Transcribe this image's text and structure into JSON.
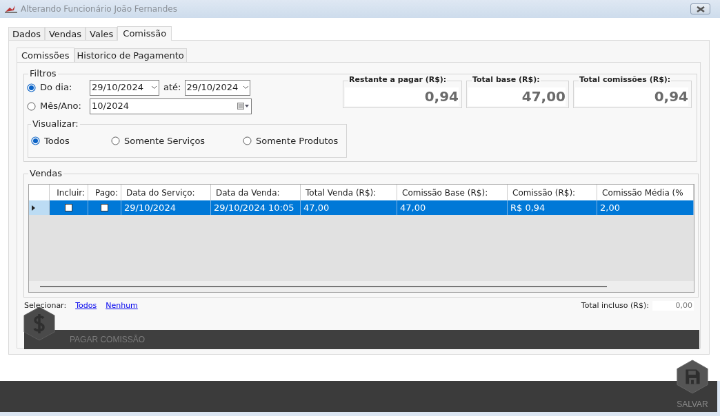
{
  "window": {
    "title": "Alterando Funcionário João Fernandes"
  },
  "tabs": [
    {
      "label": "Dados",
      "selected": false
    },
    {
      "label": "Vendas",
      "selected": false
    },
    {
      "label": "Vales",
      "selected": false
    },
    {
      "label": "Comissão",
      "selected": true
    }
  ],
  "subtabs": [
    {
      "label": "Comissões",
      "selected": true
    },
    {
      "label": "Historico de Pagamento",
      "selected": false
    }
  ],
  "filters": {
    "legend": "Filtros",
    "options": [
      {
        "kind": "range",
        "label": "Do dia:",
        "selected": true,
        "from": "29/10/2024",
        "to_label": "até:",
        "to": "29/10/2024"
      },
      {
        "kind": "month",
        "label": "Mês/Ano:",
        "selected": false,
        "value": "10/2024"
      }
    ],
    "view": {
      "legend": "Visualizar:",
      "options": [
        {
          "label": "Todos",
          "selected": true
        },
        {
          "label": "Somente Serviços",
          "selected": false
        },
        {
          "label": "Somente Produtos",
          "selected": false
        }
      ]
    }
  },
  "totals": [
    {
      "label": "Restante a pagar (R$):",
      "value": "0,94"
    },
    {
      "label": "Total base (R$):",
      "value": "47,00"
    },
    {
      "label": "Total comissões (R$):",
      "value": "0,94"
    }
  ],
  "sales": {
    "legend": "Vendas",
    "columns": [
      "Incluir:",
      "Pago:",
      "Data do Serviço:",
      "Data da Venda:",
      "Total Venda (R$):",
      "Comissão Base (R$):",
      "Comissão (R$):",
      "Comissão Média (%"
    ],
    "rows": [
      {
        "selected": true,
        "cells": [
          {
            "kind": "checkbox",
            "checked": false
          },
          {
            "kind": "checkbox",
            "checked": false
          },
          {
            "kind": "text",
            "text": "29/10/2024"
          },
          {
            "kind": "text",
            "text": "29/10/2024 10:05"
          },
          {
            "kind": "text",
            "text": "47,00"
          },
          {
            "kind": "text",
            "text": "47,00"
          },
          {
            "kind": "text",
            "text": "R$ 0,94"
          },
          {
            "kind": "text",
            "text": "2,00"
          }
        ]
      }
    ]
  },
  "select": {
    "label": "Selecionar:",
    "links": [
      "Todos",
      "Nenhum"
    ]
  },
  "total_included": {
    "label": "Total incluso (R$):",
    "value": "0,00"
  },
  "pay_button": "PAGAR COMISSÃO",
  "save_button": "SALVAR"
}
